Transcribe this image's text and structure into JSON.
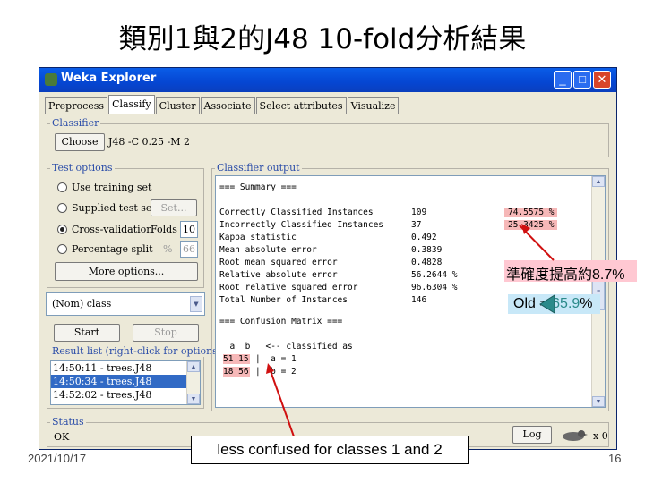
{
  "slide": {
    "title": "類別1與2的J48 10-fold分析結果",
    "date": "2021/10/17",
    "page": "16"
  },
  "window": {
    "title": "Weka Explorer",
    "controls": [
      "_",
      "□",
      "✕"
    ]
  },
  "tabs": [
    "Preprocess",
    "Classify",
    "Cluster",
    "Associate",
    "Select attributes",
    "Visualize"
  ],
  "active_tab": "Classify",
  "classifier": {
    "legend": "Classifier",
    "choose_label": "Choose",
    "value": "J48 -C 0.25 -M 2"
  },
  "test_options": {
    "legend": "Test options",
    "use_training": "Use training set",
    "supplied": "Supplied test set",
    "set_label": "Set...",
    "cross_validation": "Cross-validation",
    "folds_label": "Folds",
    "folds_value": "10",
    "percentage": "Percentage split",
    "percent_sign": "%",
    "percent_value": "66",
    "more_options": "More options..."
  },
  "class_select": "(Nom) class",
  "start_label": "Start",
  "stop_label": "Stop",
  "result_list": {
    "legend": "Result list (right-click for options)",
    "items": [
      "14:50:11 - trees.J48",
      "14:50:34 - trees.J48",
      "14:52:02 - trees.J48"
    ],
    "selected_index": 1
  },
  "output": {
    "legend": "Classifier output",
    "summary_header": "=== Summary ===",
    "rows": [
      {
        "label": "Correctly Classified Instances",
        "value": "109",
        "pct": "74.5575 %"
      },
      {
        "label": "Incorrectly Classified Instances",
        "value": "37",
        "pct": "25.3425 %"
      },
      {
        "label": "Kappa statistic",
        "value": "0.492",
        "pct": ""
      },
      {
        "label": "Mean absolute error",
        "value": "0.3839",
        "pct": ""
      },
      {
        "label": "Root mean squared error",
        "value": "0.4828",
        "pct": ""
      },
      {
        "label": "Relative absolute error",
        "value": "56.2644 %",
        "pct": ""
      },
      {
        "label": "Root relative squared error",
        "value": "96.6304 %",
        "pct": ""
      },
      {
        "label": "Total Number of Instances",
        "value": "146",
        "pct": ""
      }
    ],
    "confusion_header": "=== Confusion Matrix ===",
    "matrix_header": "  a  b   <-- classified as",
    "matrix_rows": [
      {
        "cells": "51 15",
        "label": "|  a = 1"
      },
      {
        "cells": "18 56",
        "label": "|  b = 2"
      }
    ]
  },
  "status": {
    "legend": "Status",
    "text": "OK",
    "log_label": "Log",
    "count": "x 0"
  },
  "annotations": {
    "accuracy_note": "準確度提高約8.7%",
    "old_prefix": "Old = ",
    "old_value": "65.9",
    "old_suffix": "%",
    "confusion_note": "less confused for classes 1 and 2"
  },
  "colors": {
    "highlight": "#f6b8b8",
    "annotation_pink": "#ffc8d2",
    "annotation_blue": "#c8e8f8",
    "arrow_red": "#d01010",
    "arrow_teal": "#2b8a8a",
    "selection": "#316ac5"
  }
}
